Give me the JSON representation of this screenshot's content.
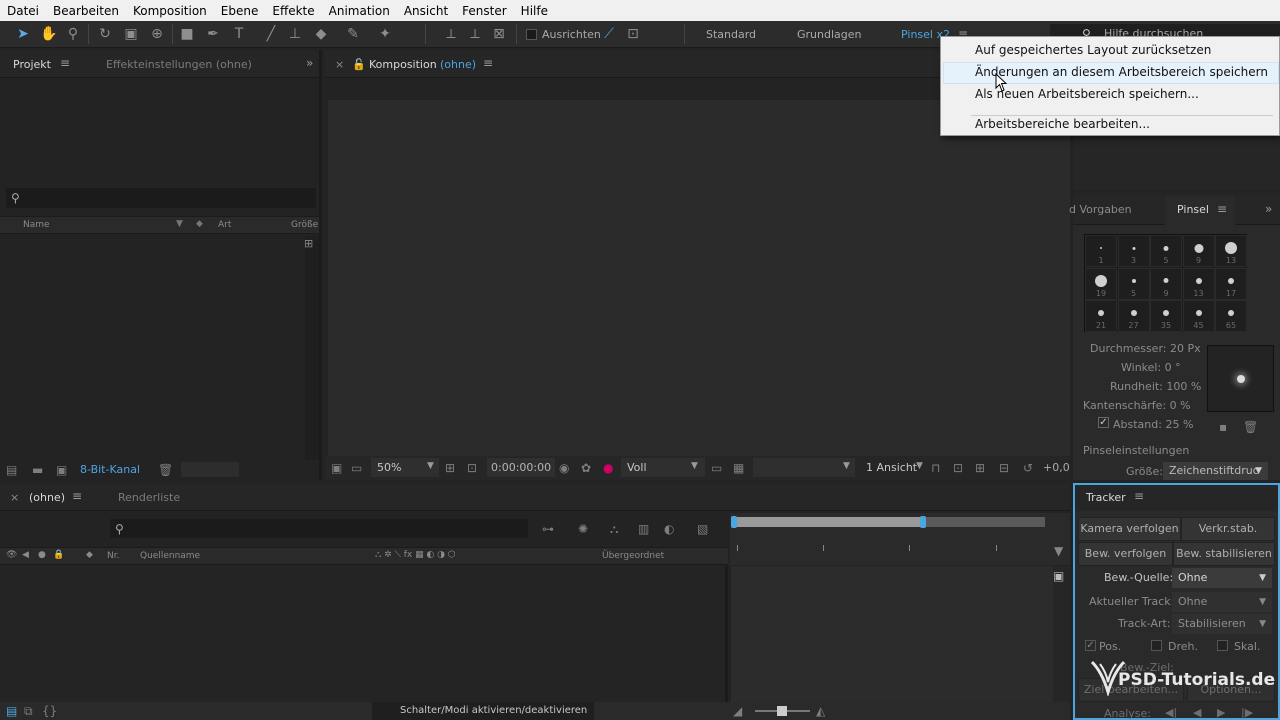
{
  "menu": [
    "Datei",
    "Bearbeiten",
    "Komposition",
    "Ebene",
    "Effekte",
    "Animation",
    "Ansicht",
    "Fenster",
    "Hilfe"
  ],
  "toolbar": {
    "align_label": "Ausrichten",
    "workspaces": [
      "Standard",
      "Grundlagen",
      "Pinsel x2"
    ],
    "search_placeholder": "Hilfe durchsuchen"
  },
  "workspace_menu": {
    "items": [
      "Auf gespeichertes Layout zurücksetzen",
      "Änderungen an diesem Arbeitsbereich speichern",
      "Als neuen Arbeitsbereich speichern...",
      "Arbeitsbereiche bearbeiten..."
    ],
    "highlighted_index": 1
  },
  "project_panel": {
    "tabs": [
      "Projekt",
      "Effekteinstellungen (ohne)"
    ],
    "columns": [
      "Name",
      "Art",
      "Größe"
    ],
    "bit_depth": "8-Bit-Kanal"
  },
  "composition_panel": {
    "close": "×",
    "title": "Komposition",
    "comp_name": "(ohne)",
    "zoom": "50%",
    "timecode": "0:00:00:00",
    "resolution": "Voll",
    "views": "1 Ansicht",
    "exposure": "+0,0"
  },
  "brushes_panel": {
    "tabs": [
      "d Vorgaben",
      "Pinsel"
    ],
    "brushes": [
      {
        "size": "1",
        "dot": 2
      },
      {
        "size": "3",
        "dot": 3
      },
      {
        "size": "5",
        "dot": 5
      },
      {
        "size": "9",
        "dot": 9
      },
      {
        "size": "13",
        "dot": 12
      },
      {
        "size": "19",
        "dot": 12
      },
      {
        "size": "5",
        "dot": 4
      },
      {
        "size": "9",
        "dot": 5
      },
      {
        "size": "13",
        "dot": 6
      },
      {
        "size": "17",
        "dot": 6
      },
      {
        "size": "21",
        "dot": 6
      },
      {
        "size": "27",
        "dot": 6
      },
      {
        "size": "35",
        "dot": 6
      },
      {
        "size": "45",
        "dot": 6
      },
      {
        "size": "65",
        "dot": 6
      }
    ],
    "diameter": "Durchmesser: 20 Px",
    "angle": "Winkel: 0 °",
    "roundness": "Rundheit: 100 %",
    "hardness": "Kantenschärfe: 0 %",
    "spacing": "Abstand: 25 %",
    "settings_label": "Pinseleinstellungen",
    "size_label": "Größe:",
    "size_value": "Zeichenstiftdruc"
  },
  "timeline_panel": {
    "tabs": [
      "(ohne)",
      "Renderliste"
    ],
    "columns": [
      "Nr.",
      "Quellenname",
      "Übergeordnet"
    ],
    "toggle_label": "Schalter/Modi aktivieren/deaktivieren"
  },
  "tracker_panel": {
    "title": "Tracker",
    "buttons": [
      "Kamera verfolgen",
      "Verkr.stab.",
      "Bew. verfolgen",
      "Bew. stabilisieren"
    ],
    "motion_source_label": "Bew.-Quelle:",
    "motion_source_value": "Ohne",
    "current_track_label": "Aktueller Track:",
    "current_track_value": "Ohne",
    "track_type_label": "Track-Art:",
    "track_type_value": "Stabilisieren",
    "checkboxes": [
      "Pos.",
      "Dreh.",
      "Skal."
    ],
    "motion_target_label": "Bew.-Ziel:",
    "edit_target": "Ziel bearbeiten...",
    "options": "Optionen...",
    "analyze_label": "Analyse:",
    "analyze_buttons": [
      "◀|",
      "◀",
      "▶",
      "|▶"
    ]
  },
  "watermark": "PSD-Tutorials.de",
  "colors": {
    "accent": "#4ba6e0",
    "highlight": "#e5f1fb"
  }
}
